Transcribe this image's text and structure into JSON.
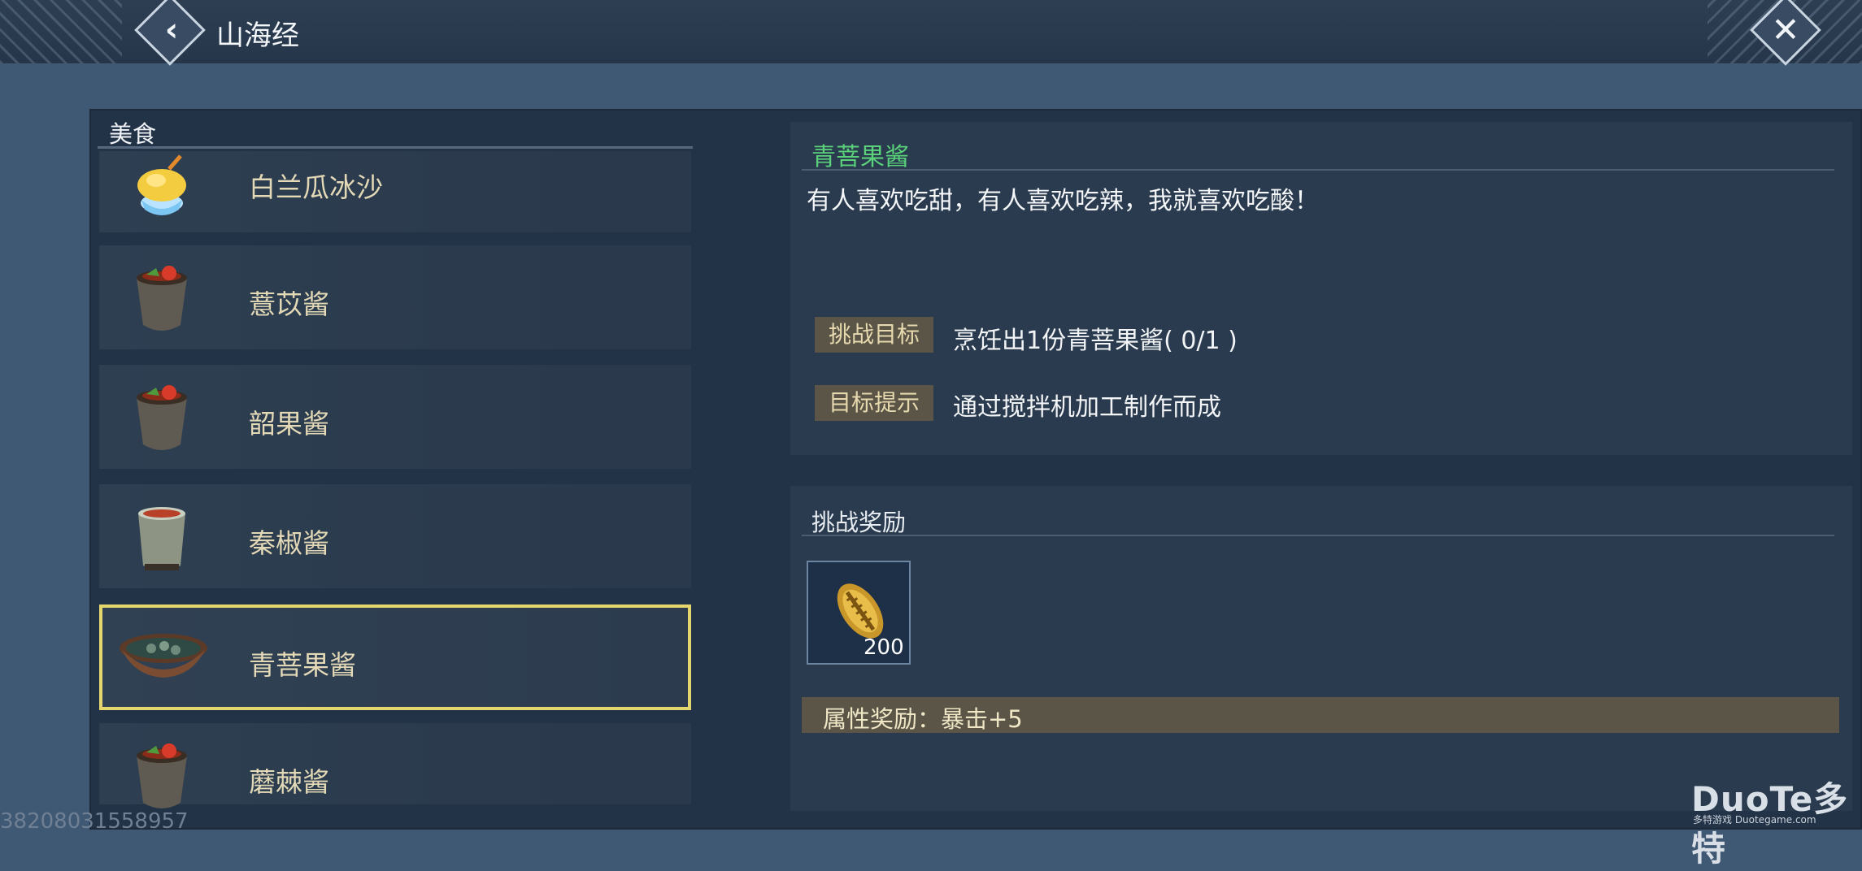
{
  "header": {
    "title": "山海经",
    "back_icon": "back-chevron-icon",
    "close_icon": "close-x-icon"
  },
  "list": {
    "header": "美食",
    "items": [
      {
        "label": "白兰瓜冰沙",
        "icon": "ice-dessert-icon",
        "selected": false
      },
      {
        "label": "薏苡酱",
        "icon": "jar-sauce-icon",
        "selected": false
      },
      {
        "label": "韶果酱",
        "icon": "jar-sauce-icon",
        "selected": false
      },
      {
        "label": "秦椒酱",
        "icon": "cup-sauce-icon",
        "selected": false
      },
      {
        "label": "青菩果酱",
        "icon": "bowl-sauce-icon",
        "selected": true
      },
      {
        "label": "蘑棘酱",
        "icon": "jar-sauce-icon",
        "selected": false
      }
    ]
  },
  "detail": {
    "title": "青菩果酱",
    "description": "有人喜欢吃甜，有人喜欢吃辣，我就喜欢吃酸！",
    "goal_tag": "挑战目标",
    "goal_value": "烹饪出1份青菩果酱( 0/1 )",
    "hint_tag": "目标提示",
    "hint_value": "通过搅拌机加工制作而成"
  },
  "reward": {
    "title": "挑战奖励",
    "item_icon": "gold-shell-icon",
    "item_count": "200",
    "attribute": "属性奖励：暴击+5"
  },
  "footer": {
    "code": "38208031558957"
  },
  "watermark": {
    "logo": "DuoTe多特",
    "sub": "多特游戏 Duotegame.com"
  },
  "colors": {
    "accent_green": "#5ad17a",
    "selected_border": "#e4d66c",
    "tag_bg": "#5b5548"
  }
}
